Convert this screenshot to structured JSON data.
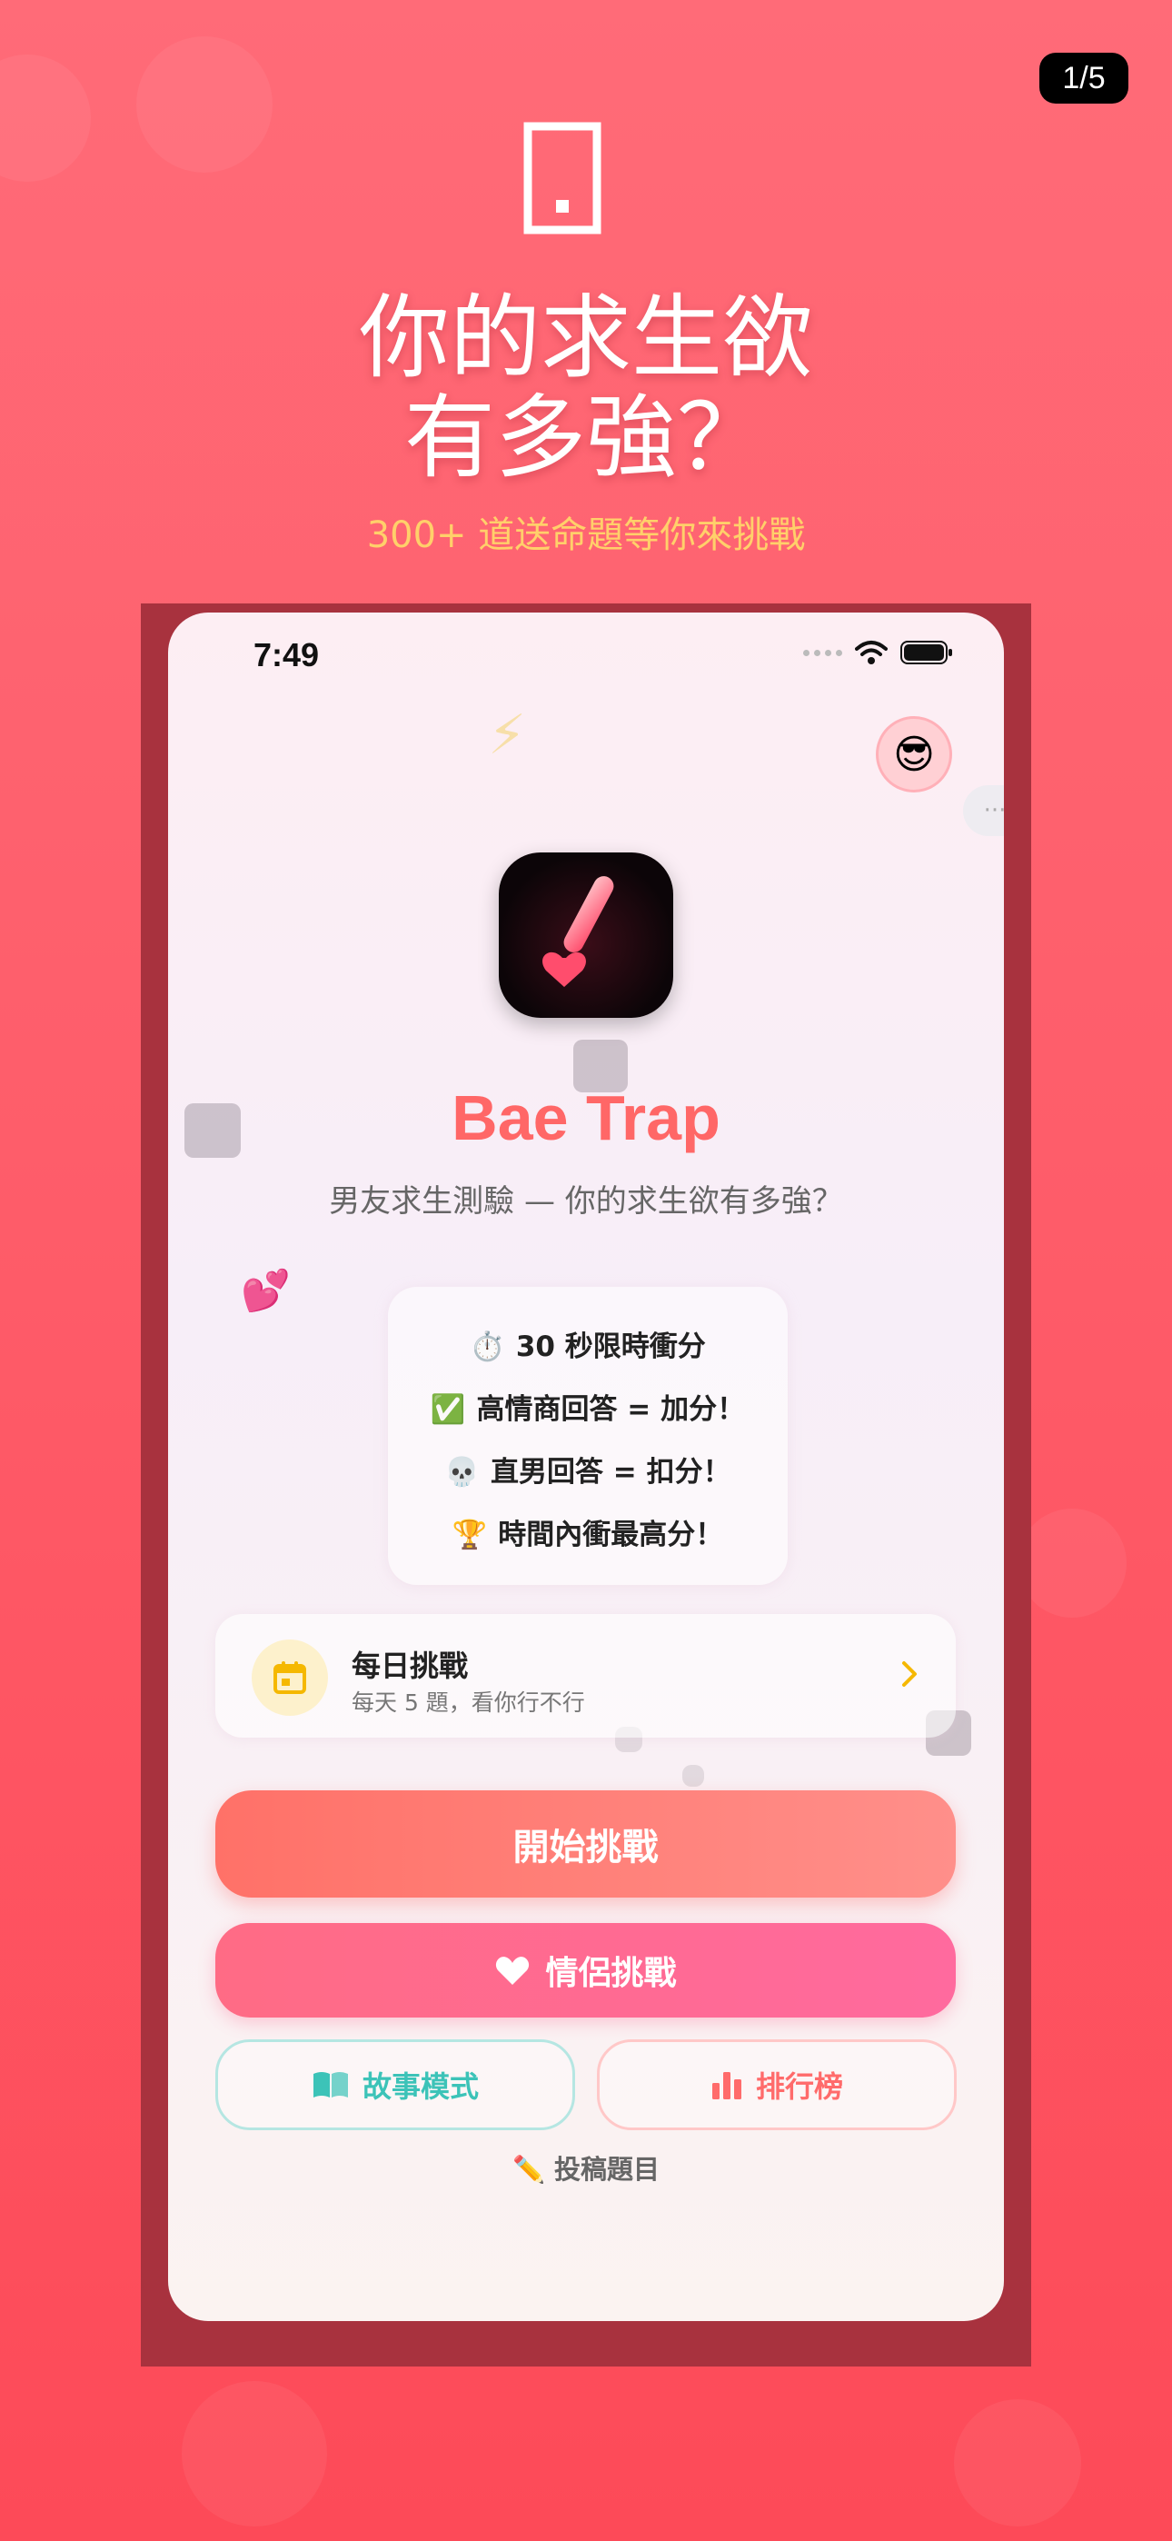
{
  "page_indicator": "1/5",
  "headline": {
    "line1": "你的求生欲",
    "line2": "有多強？"
  },
  "subheadline": "300+ 道送命題等你來挑戰",
  "status_bar": {
    "time": "7:49"
  },
  "avatar": {
    "emoji": "😎"
  },
  "app": {
    "title": "Bae Trap",
    "subtitle": "男友求生測驗 — 你的求生欲有多強？"
  },
  "rules": [
    {
      "emoji": "⏱️",
      "text": "30 秒限時衝分"
    },
    {
      "emoji": "✅",
      "text": "高情商回答 = 加分！"
    },
    {
      "emoji": "💀",
      "text": "直男回答 = 扣分！"
    },
    {
      "emoji": "🏆",
      "text": "時間內衝最高分！"
    }
  ],
  "daily_challenge": {
    "title": "每日挑戰",
    "subtitle": "每天 5 題，看你行不行"
  },
  "buttons": {
    "start": "開始挑戰",
    "couple": "情侶挑戰",
    "story": "故事模式",
    "ranking": "排行榜",
    "submit": "投稿題目"
  },
  "colors": {
    "background": "#fe5d6a",
    "accent_title": "#ff6767",
    "subheadline": "#ffd06a",
    "story_teal": "#3cc3b8",
    "ranking_red": "#ff6b6b"
  },
  "icons": {
    "page_top": "phone-outline-icon",
    "app_icon": "exclamation-heart-icon",
    "daily": "calendar-icon",
    "couple": "heart-icon",
    "story": "book-icon",
    "ranking": "bar-chart-icon",
    "submit": "pencil-icon"
  }
}
